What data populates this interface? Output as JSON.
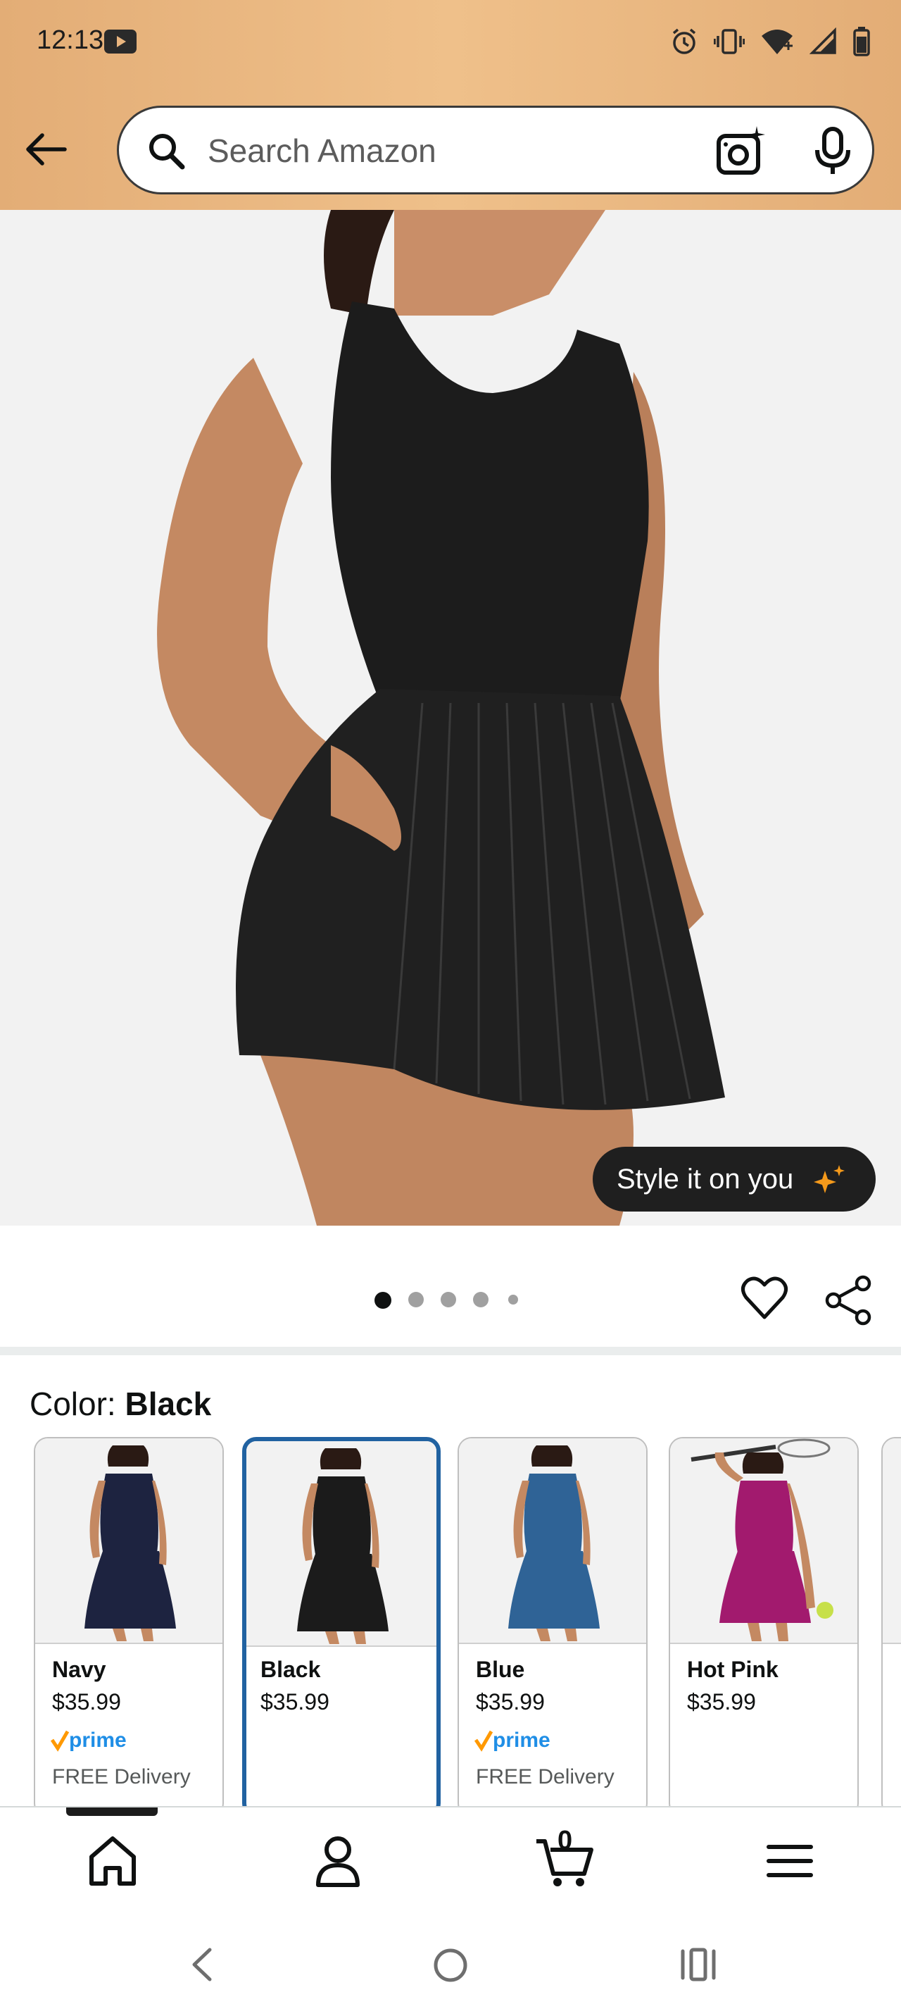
{
  "status_bar": {
    "time": "12:13",
    "icons": [
      "youtube-icon",
      "alarm-icon",
      "vibrate-icon",
      "wifi-icon",
      "signal-icon",
      "battery-icon"
    ]
  },
  "search": {
    "placeholder": "Search Amazon"
  },
  "product": {
    "style_button_label": "Style it on you",
    "image_count": 5,
    "active_image_index": 0
  },
  "color": {
    "label": "Color:",
    "selected": "Black",
    "options": [
      {
        "name": "Navy",
        "price": "$35.99",
        "prime": "prime",
        "delivery": "FREE Delivery",
        "color_hex": "#1d2340"
      },
      {
        "name": "Black",
        "price": "$35.99",
        "prime": "",
        "delivery": "",
        "color_hex": "#1b1b1b"
      },
      {
        "name": "Blue",
        "price": "$35.99",
        "prime": "prime",
        "delivery": "FREE Delivery",
        "color_hex": "#2f6396"
      },
      {
        "name": "Hot Pink",
        "price": "$35.99",
        "prime": "",
        "delivery": "",
        "color_hex": "#a21a6e"
      }
    ]
  },
  "bottom_nav": {
    "items": [
      "home-icon",
      "account-icon",
      "cart-icon",
      "menu-icon"
    ],
    "cart_count": "0"
  },
  "colors": {
    "header_bg": "#e9b57f",
    "selected_border": "#2162a1",
    "prime_blue": "#1f8ee6",
    "prime_check": "#ff9900"
  }
}
